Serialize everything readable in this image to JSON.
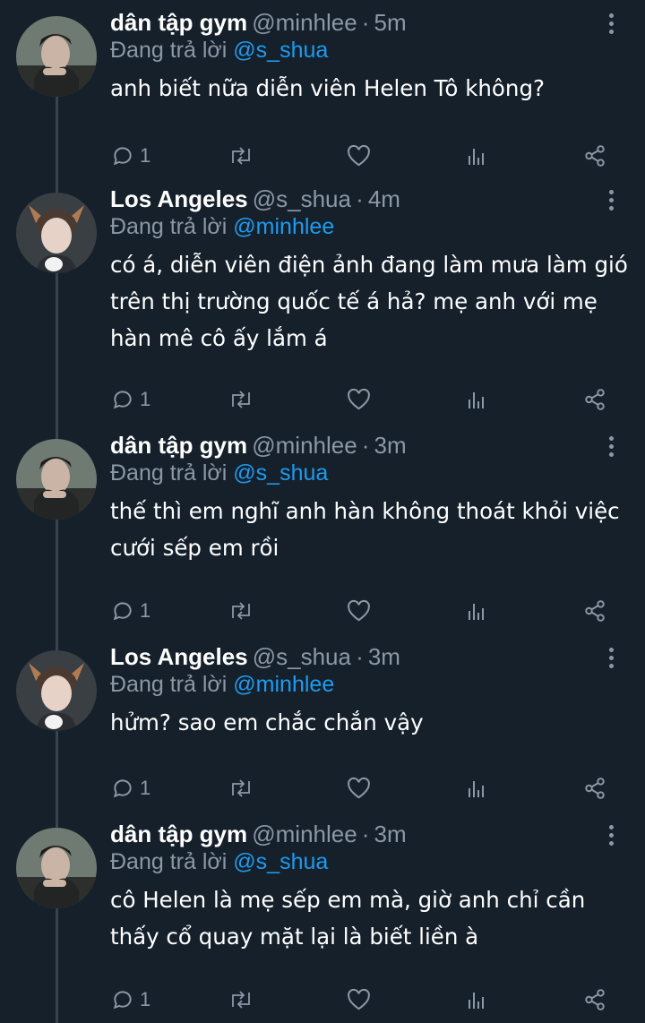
{
  "colors": {
    "background": "#15202b",
    "secondary": "#8b98a5",
    "link": "#1d9bf0",
    "line": "#38444d"
  },
  "tweets": [
    {
      "name": "dân tập gym",
      "handle": "@minhlee",
      "time": "5m",
      "reply_prefix": "Đang trả lời",
      "reply_to": "@s_shua",
      "text": "anh biết nữa diễn viên Helen Tô không?",
      "reply_count": "1",
      "avatar": "avatar-minhlee"
    },
    {
      "name": "Los Angeles",
      "handle": "@s_shua",
      "time": "4m",
      "reply_prefix": "Đang trả lời",
      "reply_to": "@minhlee",
      "text": "có á, diễn viên điện ảnh đang làm mưa làm gió trên thị trường quốc tế á hả? mẹ anh với mẹ hàn mê cô ấy lắm á",
      "reply_count": "1",
      "avatar": "avatar-s-shua"
    },
    {
      "name": "dân tập gym",
      "handle": "@minhlee",
      "time": "3m",
      "reply_prefix": "Đang trả lời",
      "reply_to": "@s_shua",
      "text": "thế thì em nghĩ anh hàn không thoát khỏi việc cưới sếp em rồi",
      "reply_count": "1",
      "avatar": "avatar-minhlee"
    },
    {
      "name": "Los Angeles",
      "handle": "@s_shua",
      "time": "3m",
      "reply_prefix": "Đang trả lời",
      "reply_to": "@minhlee",
      "text": "hửm? sao em chắc chắn vậy",
      "reply_count": "1",
      "avatar": "avatar-s-shua"
    },
    {
      "name": "dân tập gym",
      "handle": "@minhlee",
      "time": "3m",
      "reply_prefix": "Đang trả lời",
      "reply_to": "@s_shua",
      "text": "cô Helen là mẹ sếp em mà, giờ anh chỉ cần thấy cổ quay mặt lại là biết liền à",
      "reply_count": "1",
      "avatar": "avatar-minhlee"
    }
  ],
  "icons": [
    "reply-icon",
    "retweet-icon",
    "like-icon",
    "views-icon",
    "share-icon",
    "more-icon"
  ]
}
